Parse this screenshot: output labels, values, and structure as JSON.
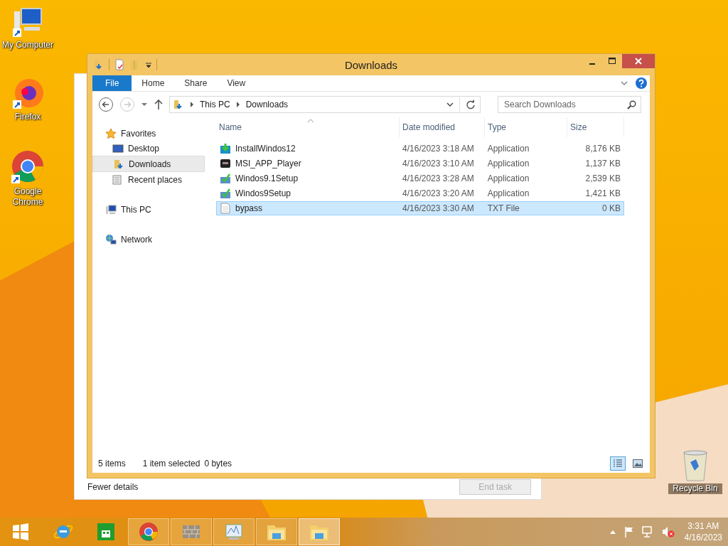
{
  "desktop_icons": [
    {
      "label": "My Computer",
      "kind": "computer"
    },
    {
      "label": "Firefox",
      "kind": "firefox"
    },
    {
      "label": "Google Chrome",
      "kind": "chrome"
    }
  ],
  "recycle_bin": {
    "label": "Recycle Bin"
  },
  "background_window": {
    "link": "Fewer details",
    "button": "End task",
    "button_disabled": true
  },
  "explorer": {
    "title": "Downloads",
    "ribbon_tabs": [
      {
        "label": "File",
        "kind": "file",
        "selected": false
      },
      {
        "label": "Home",
        "kind": "tab",
        "selected": false
      },
      {
        "label": "Share",
        "kind": "tab",
        "selected": false
      },
      {
        "label": "View",
        "kind": "tab",
        "selected": false
      }
    ],
    "address": [
      "This PC",
      "Downloads"
    ],
    "search": {
      "placeholder": "Search Downloads"
    },
    "nav": [
      {
        "label": "Favorites",
        "kind": "star",
        "selected": false,
        "children": [
          {
            "label": "Desktop",
            "kind": "desktop",
            "selected": false
          },
          {
            "label": "Downloads",
            "kind": "downloads",
            "selected": true
          },
          {
            "label": "Recent places",
            "kind": "recent",
            "selected": false
          }
        ]
      },
      {
        "label": "This PC",
        "kind": "pc",
        "selected": false
      },
      {
        "label": "Network",
        "kind": "network",
        "selected": false
      }
    ],
    "columns": [
      {
        "label": "Name",
        "sorted": true
      },
      {
        "label": "Date modified",
        "sorted": false
      },
      {
        "label": "Type",
        "sorted": false
      },
      {
        "label": "Size",
        "sorted": false
      }
    ],
    "rows": [
      {
        "name": "InstallWindos12",
        "date": "4/16/2023 3:18 AM",
        "type": "Application",
        "size": "8,176 KB",
        "kind": "installer",
        "selected": false
      },
      {
        "name": "MSI_APP_Player",
        "date": "4/16/2023 3:10 AM",
        "type": "Application",
        "size": "1,137 KB",
        "kind": "player",
        "selected": false
      },
      {
        "name": "Windos9.1Setup",
        "date": "4/16/2023 3:28 AM",
        "type": "Application",
        "size": "2,539 KB",
        "kind": "setup",
        "selected": false
      },
      {
        "name": "Windos9Setup",
        "date": "4/16/2023 3:20 AM",
        "type": "Application",
        "size": "1,421 KB",
        "kind": "setup",
        "selected": false
      },
      {
        "name": "bypass",
        "date": "4/16/2023 3:30 AM",
        "type": "TXT File",
        "size": "0 KB",
        "kind": "text",
        "selected": true
      }
    ],
    "status": {
      "items": "5 items",
      "selection": "1 item selected",
      "bytes": "0 bytes"
    },
    "views": [
      {
        "kind": "details",
        "selected": true
      },
      {
        "kind": "thumbnails",
        "selected": false
      }
    ]
  },
  "taskbar": {
    "apps": [
      {
        "kind": "start",
        "open": false,
        "active": false
      },
      {
        "kind": "ie",
        "open": false,
        "active": false
      },
      {
        "kind": "store",
        "open": false,
        "active": false
      },
      {
        "kind": "chrome",
        "open": true,
        "active": false
      },
      {
        "kind": "taskmgr",
        "open": true,
        "active": false
      },
      {
        "kind": "perfmon",
        "open": true,
        "active": false
      },
      {
        "kind": "explorer",
        "open": true,
        "active": false
      },
      {
        "kind": "explorer",
        "open": true,
        "active": true
      }
    ],
    "time": "3:31 AM",
    "date": "4/16/2023"
  }
}
